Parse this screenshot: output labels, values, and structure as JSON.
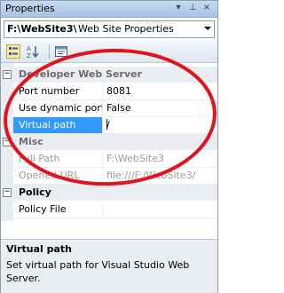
{
  "window": {
    "title": "Properties",
    "buttons": {
      "dropdown": "▾",
      "pin": "⊥",
      "close": "×"
    }
  },
  "object_selector": {
    "name": "F:\\WebSite3\\",
    "type": "Web Site Properties"
  },
  "toolbar": {
    "icons": [
      "categorized-icon",
      "alphabetical-icon",
      "property-pages-icon"
    ]
  },
  "grid": {
    "categories": [
      {
        "label": "Developer Web Server",
        "properties": [
          {
            "name": "Port number",
            "value": "8081"
          },
          {
            "name": "Use dynamic ports",
            "value": "False"
          },
          {
            "name": "Virtual path",
            "value": "/"
          }
        ]
      },
      {
        "label": "Misc",
        "properties": [
          {
            "name": "Full Path",
            "value": "F:\\WebSite3"
          },
          {
            "name": "Opened URL",
            "value": "file:///F:/WebSite3/"
          }
        ]
      },
      {
        "label": "Policy",
        "properties": [
          {
            "name": "Policy File",
            "value": ""
          }
        ]
      }
    ]
  },
  "description": {
    "title": "Virtual path",
    "text": "Set virtual path for Visual Studio Web Server."
  },
  "colors": {
    "selection": "#3399ff",
    "annotation": "#e0141e",
    "category_bg": "#e9ecf0"
  }
}
